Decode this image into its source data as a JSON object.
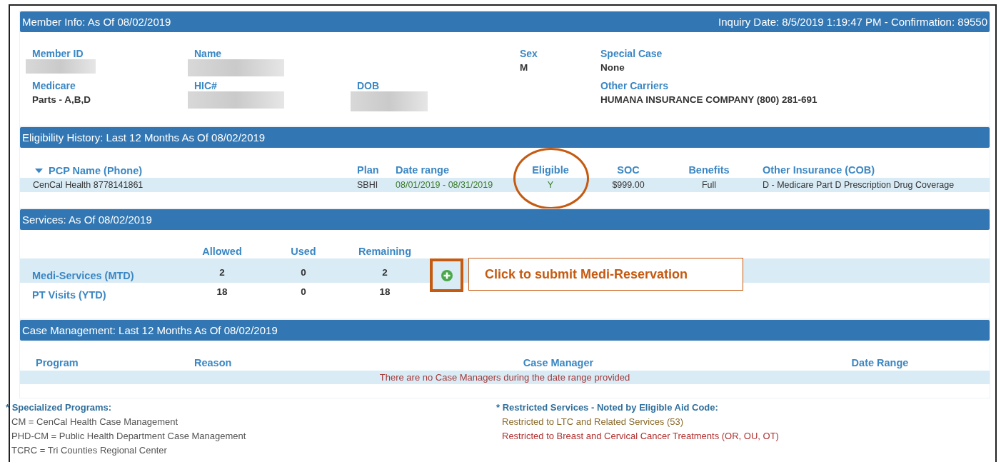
{
  "member_info": {
    "title": "Member Info: As Of 08/02/2019",
    "inquiry": "Inquiry Date: 8/5/2019 1:19:47 PM - Confirmation: 89550",
    "rows": [
      [
        {
          "label": "Member ID",
          "kind": "redacted"
        },
        {
          "label": "Name",
          "kind": "redacted"
        },
        null,
        {
          "label": "Sex",
          "kind": "text",
          "value": "M"
        },
        {
          "label": "Special Case",
          "kind": "text",
          "value": "None"
        }
      ],
      [
        {
          "label": "Medicare",
          "kind": "text",
          "value": "Parts - A,B,D"
        },
        {
          "label": "HIC#",
          "kind": "redacted"
        },
        {
          "label": "DOB",
          "kind": "redacted"
        },
        null,
        {
          "label": "Other Carriers",
          "kind": "text",
          "value": "HUMANA INSURANCE COMPANY (800) 281-691"
        }
      ]
    ]
  },
  "eligibility": {
    "title": "Eligibility History: Last 12 Months As Of 08/02/2019",
    "columns": [
      {
        "label": "PCP Name (Phone)",
        "sorted": true,
        "circled": false
      },
      {
        "label": "Plan",
        "sorted": false,
        "circled": false
      },
      {
        "label": "Date range",
        "sorted": false,
        "circled": false
      },
      {
        "label": "Eligible",
        "sorted": false,
        "circled": true
      },
      {
        "label": "SOC",
        "sorted": false,
        "circled": false
      },
      {
        "label": "Benefits",
        "sorted": false,
        "circled": false
      },
      {
        "label": "Other Insurance (COB)",
        "sorted": false,
        "circled": false
      }
    ],
    "rows": [
      [
        "CenCal Health 8778141861",
        "SBHI",
        "08/01/2019 - 08/31/2019",
        "Y",
        "$999.00",
        "Full",
        "D - Medicare Part D Prescription Drug Coverage"
      ]
    ]
  },
  "services": {
    "title": "Services: As Of 08/02/2019",
    "columns": [
      "Allowed",
      "Used",
      "Remaining"
    ],
    "rows": [
      {
        "name": "Medi-Services (MTD)",
        "values": [
          "2",
          "0",
          "2"
        ],
        "reservable": true
      },
      {
        "name": "PT Visits (YTD)",
        "values": [
          "18",
          "0",
          "18"
        ],
        "reservable": false
      }
    ],
    "callout": "Click to submit Medi-Reservation"
  },
  "case_management": {
    "title": "Case Management: Last 12 Months As Of 08/02/2019",
    "columns": [
      "Program",
      "Reason",
      "Case Manager",
      "Date Range"
    ],
    "message": "There are no Case Managers during the date range provided"
  },
  "notes": {
    "programs": {
      "title": "* Specialized Programs:",
      "items": [
        "CM = CenCal Health Case Management",
        "PHD-CM = Public Health Department Case Management",
        "TCRC = Tri Counties Regional Center"
      ]
    },
    "restricted": {
      "title": "* Restricted Services - Noted by Eligible Aid Code:",
      "items": [
        {
          "text": "Restricted to LTC and Related Services (53)",
          "color": "#8a6a2a"
        },
        {
          "text": "Restricted to Breast and Cervical Cancer Treatments (OR, OU, OT)",
          "color": "#b03030"
        }
      ]
    }
  }
}
